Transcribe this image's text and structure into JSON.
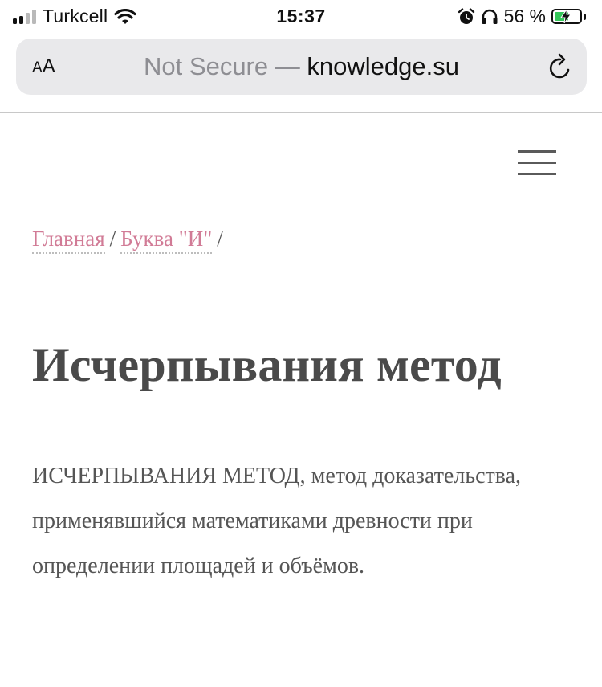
{
  "status_bar": {
    "carrier": "Turkcell",
    "time": "15:37",
    "battery_percent": "56 %",
    "battery_level": 0.56,
    "battery_color": "#34c759",
    "icons": [
      "signal-icon",
      "wifi-icon",
      "alarm-icon",
      "headphones-icon",
      "battery-icon"
    ]
  },
  "browser": {
    "text_size_label_small": "A",
    "text_size_label_large": "A",
    "security_label": "Not Secure",
    "separator": "—",
    "domain": "knowledge.su"
  },
  "page": {
    "menu_icon": "hamburger-menu-icon",
    "breadcrumb": {
      "home": "Главная",
      "category": "Буква \"И\"",
      "separator": "/"
    },
    "title": "Исчерпывания метод",
    "body": "ИСЧЕРПЫВАНИЯ МЕТОД, метод доказательства, применявшийся математиками древности при определении площадей и объёмов."
  },
  "colors": {
    "link": "#d17b96",
    "text": "#555555",
    "title": "#4a4a4a",
    "address_bar_bg": "#e9e9eb"
  }
}
